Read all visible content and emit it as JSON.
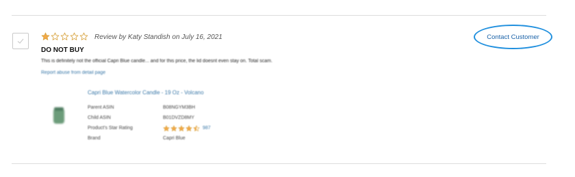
{
  "review": {
    "rating": 1,
    "max_rating": 5,
    "meta": "Review by Katy Standish on July 16, 2021",
    "title": "DO NOT BUY",
    "body": "This is definitely not the official Capri Blue candle... and for this price, the lid doesnt even stay on. Total scam.",
    "report_link": "Report abuse from detail page"
  },
  "contact_button": {
    "label": "Contact Customer"
  },
  "product": {
    "title": "Capri Blue Watercolor Candle - 19 Oz - Volcano",
    "attributes": [
      {
        "key": "Parent ASIN",
        "value": "B08NGYM3BH"
      },
      {
        "key": "Child ASIN",
        "value": "B01DVZD8MY"
      },
      {
        "key": "Product's Star Rating",
        "value": ""
      },
      {
        "key": "Brand",
        "value": "Capri Blue"
      }
    ],
    "star_rating": 4.5,
    "rating_count": "987"
  },
  "colors": {
    "star_filled": "#f3a847",
    "star_outline": "#d9a441",
    "link": "#3a78a8",
    "contact_outline": "#1f8fde"
  }
}
